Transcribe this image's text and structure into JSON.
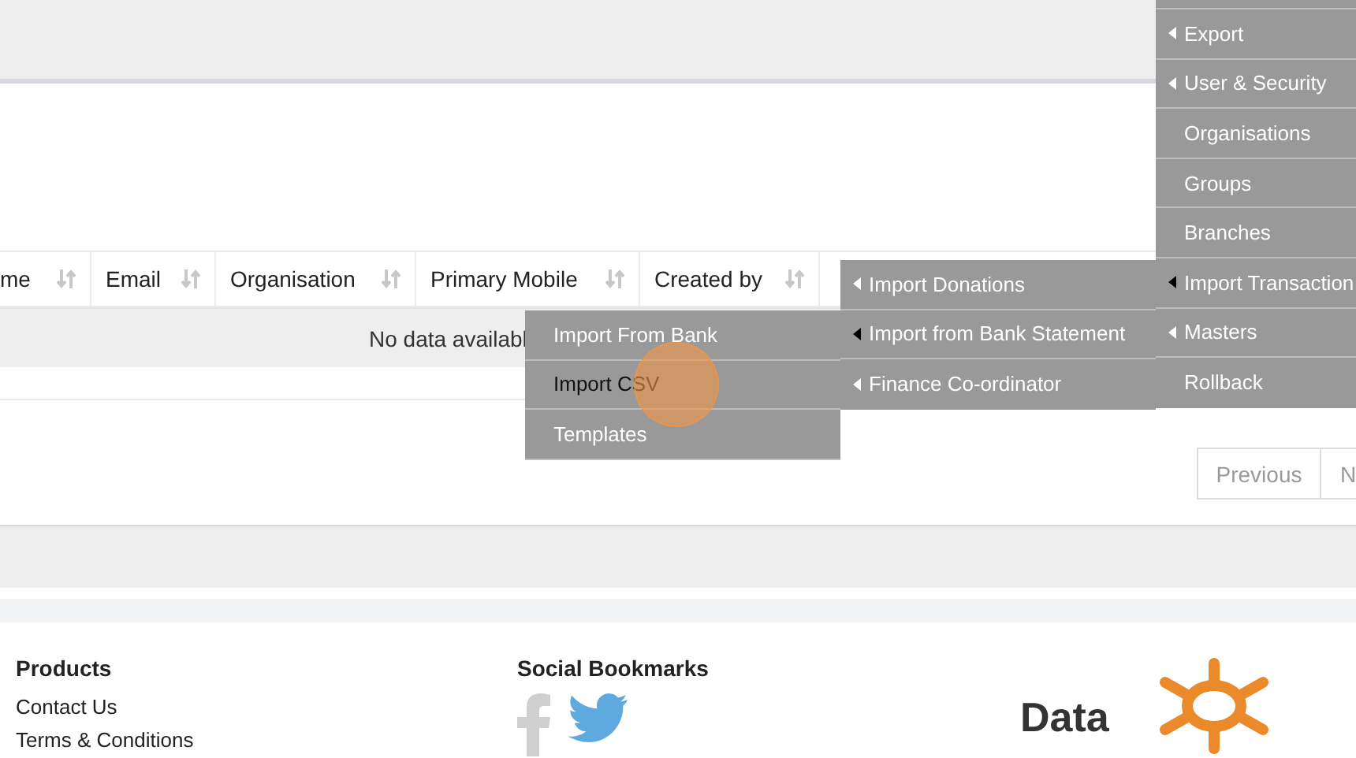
{
  "table": {
    "columns": [
      {
        "label": "me",
        "sortable": true
      },
      {
        "label": "Email",
        "sortable": true
      },
      {
        "label": "Organisation",
        "sortable": true
      },
      {
        "label": "Primary Mobile",
        "sortable": true
      },
      {
        "label": "Created by",
        "sortable": true
      }
    ],
    "empty_message": "No data availabl"
  },
  "pagination": [
    "Previous",
    "N"
  ],
  "main_menu": [
    {
      "label": "Export",
      "submenu": true,
      "highlighted": false
    },
    {
      "label": "User & Security",
      "submenu": true,
      "highlighted": false
    },
    {
      "label": "Organisations",
      "submenu": false,
      "highlighted": false
    },
    {
      "label": "Groups",
      "submenu": false,
      "highlighted": false
    },
    {
      "label": "Branches",
      "submenu": false,
      "highlighted": false
    },
    {
      "label": "Import Transaction",
      "submenu": true,
      "highlighted": true
    },
    {
      "label": "Masters",
      "submenu": true,
      "highlighted": false
    },
    {
      "label": "Rollback",
      "submenu": false,
      "highlighted": false
    }
  ],
  "import_menu": [
    {
      "label": "Import Donations",
      "submenu": true,
      "highlighted": false
    },
    {
      "label": "Import from Bank Statement",
      "submenu": true,
      "highlighted": true
    },
    {
      "label": "Finance Co-ordinator",
      "submenu": true,
      "highlighted": false
    }
  ],
  "bank_menu": [
    {
      "label": "Import From Bank",
      "highlighted": false,
      "pointer": false
    },
    {
      "label": "Import CSV",
      "highlighted": true,
      "pointer": true
    },
    {
      "label": "Templates",
      "highlighted": false,
      "pointer": false
    }
  ],
  "footer": {
    "products": {
      "title": "Products",
      "links": [
        "Contact Us",
        "Terms & Conditions"
      ]
    },
    "social": {
      "title": "Social Bookmarks"
    },
    "logo_text": "Data"
  }
}
